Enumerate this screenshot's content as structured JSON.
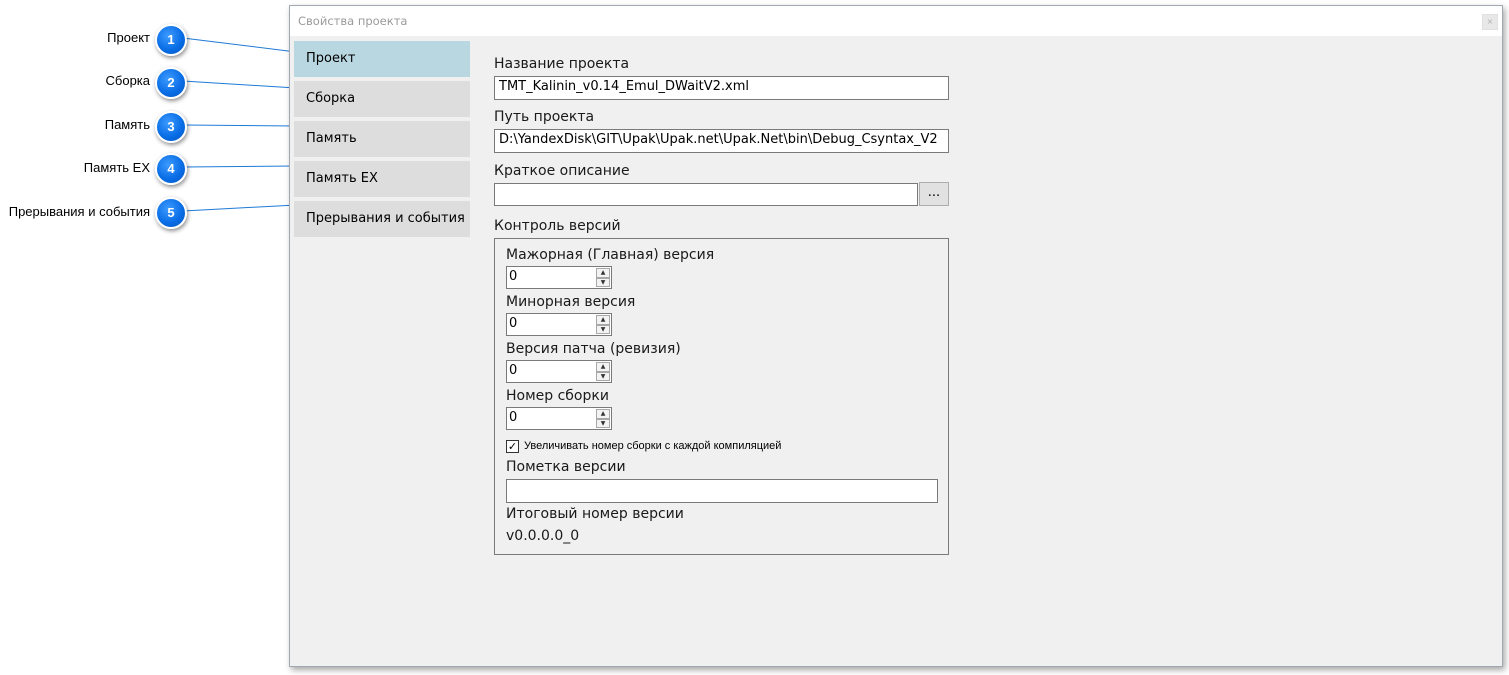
{
  "callouts": [
    {
      "number": "1",
      "label": "Проект"
    },
    {
      "number": "2",
      "label": "Сборка"
    },
    {
      "number": "3",
      "label": "Память"
    },
    {
      "number": "4",
      "label": "Память EX"
    },
    {
      "number": "5",
      "label": "Прерывания и события"
    }
  ],
  "dialog": {
    "title": "Свойства проекта",
    "close_glyph": "×"
  },
  "nav": {
    "items": [
      {
        "label": "Проект",
        "active": true
      },
      {
        "label": "Сборка",
        "active": false
      },
      {
        "label": "Память",
        "active": false
      },
      {
        "label": "Память EX",
        "active": false
      },
      {
        "label": "Прерывания и события",
        "active": false
      }
    ]
  },
  "project": {
    "name_label": "Название проекта",
    "name_value": "TMT_Kalinin_v0.14_Emul_DWaitV2.xml",
    "path_label": "Путь проекта",
    "path_value": "D:\\YandexDisk\\GIT\\Upak\\Upak.net\\Upak.Net\\bin\\Debug_Csyntax_V2",
    "desc_label": "Краткое описание",
    "desc_value": "",
    "desc_button": "..."
  },
  "versions": {
    "group_label": "Контроль версий",
    "major_label": "Мажорная (Главная) версия",
    "major_value": "0",
    "minor_label": "Минорная версия",
    "minor_value": "0",
    "patch_label": "Версия патча (ревизия)",
    "patch_value": "0",
    "build_label": "Номер сборки",
    "build_value": "0",
    "auto_increment_label": "Увеличивать номер сборки с каждой компиляцией",
    "auto_increment_checked": true,
    "tag_label": "Пометка версии",
    "tag_value": "",
    "final_label": "Итоговый номер версии",
    "final_value": "v0.0.0.0_0"
  }
}
